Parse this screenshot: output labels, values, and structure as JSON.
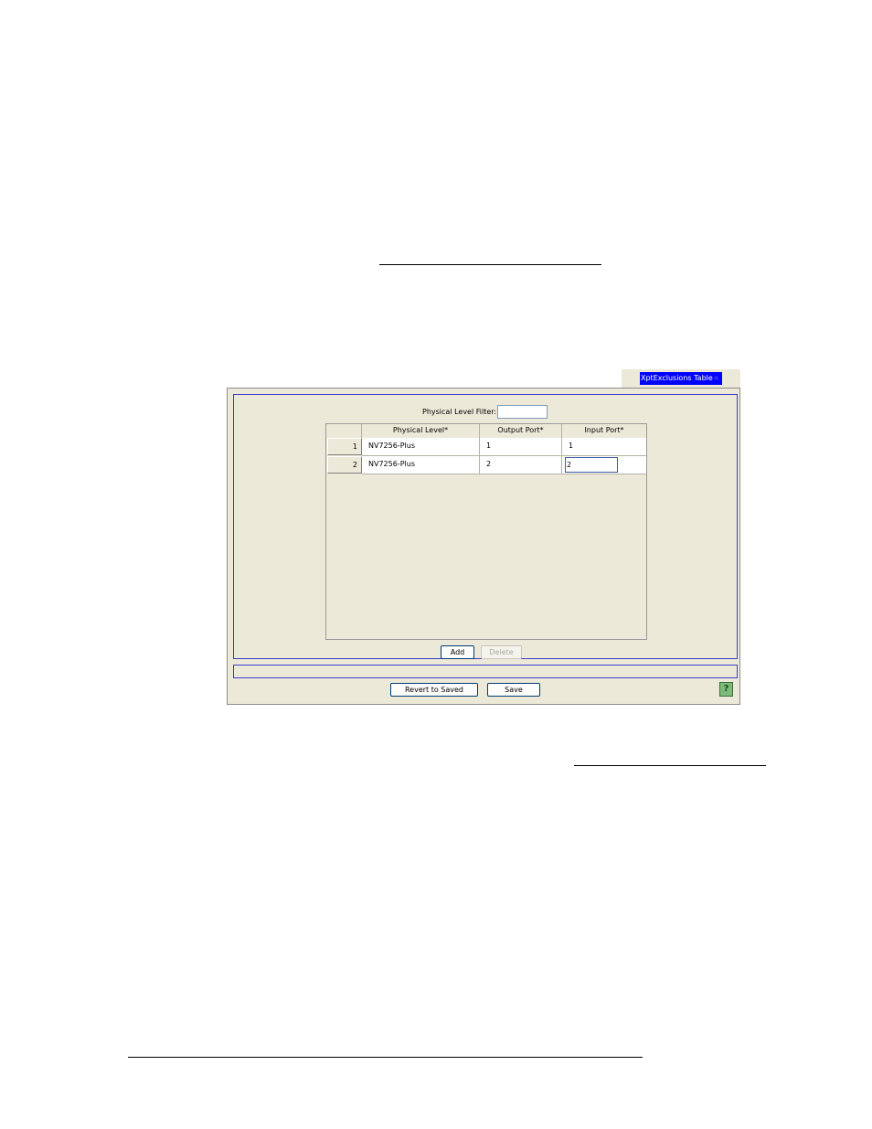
{
  "tab": {
    "label": "XptExclusions Table",
    "close_glyph": "×"
  },
  "filter": {
    "label": "Physical Level Filter:",
    "value": ""
  },
  "table": {
    "columns": [
      "Physical Level*",
      "Output Port*",
      "Input Port*"
    ],
    "rows": [
      {
        "num": "1",
        "physical_level": "NV7256-Plus",
        "output_port": "1",
        "input_port": "1"
      },
      {
        "num": "2",
        "physical_level": "NV7256-Plus",
        "output_port": "2",
        "input_port": "2"
      }
    ]
  },
  "buttons": {
    "add": "Add",
    "delete": "Delete",
    "revert": "Revert to Saved",
    "save": "Save"
  },
  "help_icon": {
    "glyph": "?"
  }
}
